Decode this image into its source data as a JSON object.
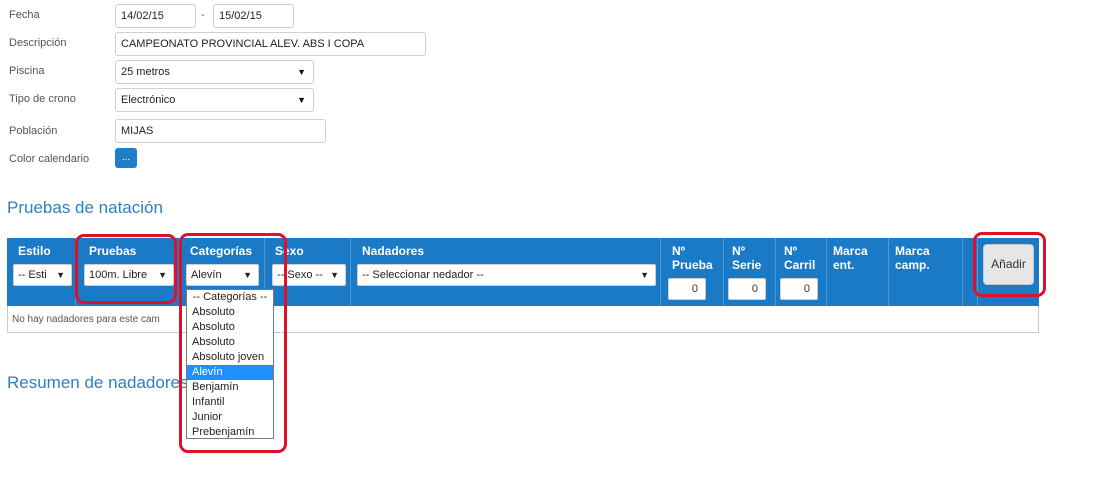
{
  "form": {
    "fecha_label": "Fecha",
    "fecha_from": "14/02/15",
    "fecha_sep": "-",
    "fecha_to": "15/02/15",
    "descripcion_label": "Descripción",
    "descripcion_value": "CAMPEONATO PROVINCIAL ALEV. ABS I COPA",
    "piscina_label": "Piscina",
    "piscina_value": "25 metros",
    "crono_label": "Tipo de crono",
    "crono_value": "Electrónico",
    "poblacion_label": "Población",
    "poblacion_value": "MIJAS",
    "color_label": "Color calendario",
    "color_button": "...",
    "accent_color": "#1f7dc9"
  },
  "pruebas": {
    "title": "Pruebas de natación",
    "headers": {
      "estilo": "Estilo",
      "pruebas": "Pruebas",
      "categorias": "Categorías",
      "sexo": "Sexo",
      "nadadores": "Nadadores",
      "n_prueba": "Nº Prueba",
      "n_serie": "Nº Serie",
      "n_carril": "Nº Carril",
      "marca_ent": "Marca ent.",
      "marca_camp": "Marca camp."
    },
    "selects": {
      "estilo": "-- Esti",
      "pruebas": "100m. Libre",
      "categorias": "Alevín",
      "sexo": "-- Sexo --",
      "nadadores": "-- Seleccionar nedador --"
    },
    "numbers": {
      "prueba": "0",
      "serie": "0",
      "carril": "0"
    },
    "add_button": "Añadir",
    "empty_message": "No hay nadadores para este cam",
    "header_color": "#1a7ac6",
    "categorias_options": [
      "-- Categorías --",
      "Absoluto",
      "Absoluto",
      "Absoluto",
      "Absoluto joven",
      "Alevín",
      "Benjamín",
      "Infantil",
      "Junior",
      "Prebenjamín"
    ],
    "categorias_selected_index": 5
  },
  "resumen": {
    "title": "Resumen de nadadores"
  },
  "highlight_color": "#e0102a"
}
